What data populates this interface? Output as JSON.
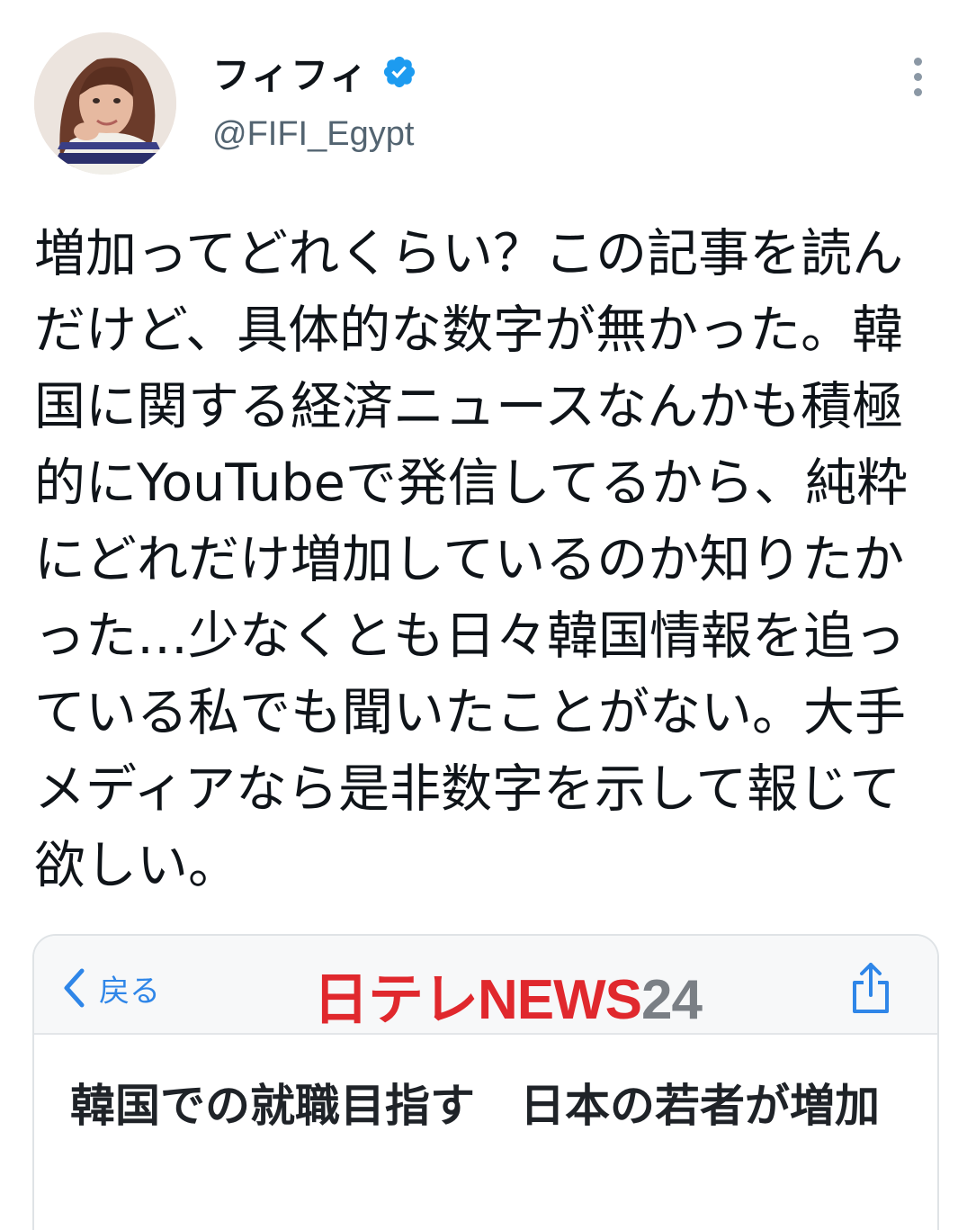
{
  "author": {
    "display_name": "フィフィ",
    "handle": "@FIFI_Egypt"
  },
  "icons": {
    "verified": "verified-badge-icon",
    "more": "more-vertical-icon",
    "back": "chevron-left-icon",
    "share": "share-icon",
    "avatar": "profile-photo"
  },
  "colors": {
    "verified": "#1d9bf0",
    "text": "#0f1419",
    "handle": "#536471",
    "link_blue": "#2f86e8",
    "logo_red": "#e0282d",
    "logo_gray": "#7a7f85"
  },
  "tweet": {
    "text": "増加ってどれくらい？この記事を読んだけど、具体的な数字が無かった。韓国に関する経済ニュースなんかも積極的にYouTubeで発信してるから、純粋にどれだけ増加しているのか知りたかった…少なくとも日々韓国情報を追っている私でも聞いたことがない。大手メディアなら是非数字を示して報じて欲しい。"
  },
  "card": {
    "back_label": "戻る",
    "logo_brand": "日テレNEWS",
    "logo_number": "24",
    "headline": "韓国での就職目指す　日本の若者が増加"
  }
}
